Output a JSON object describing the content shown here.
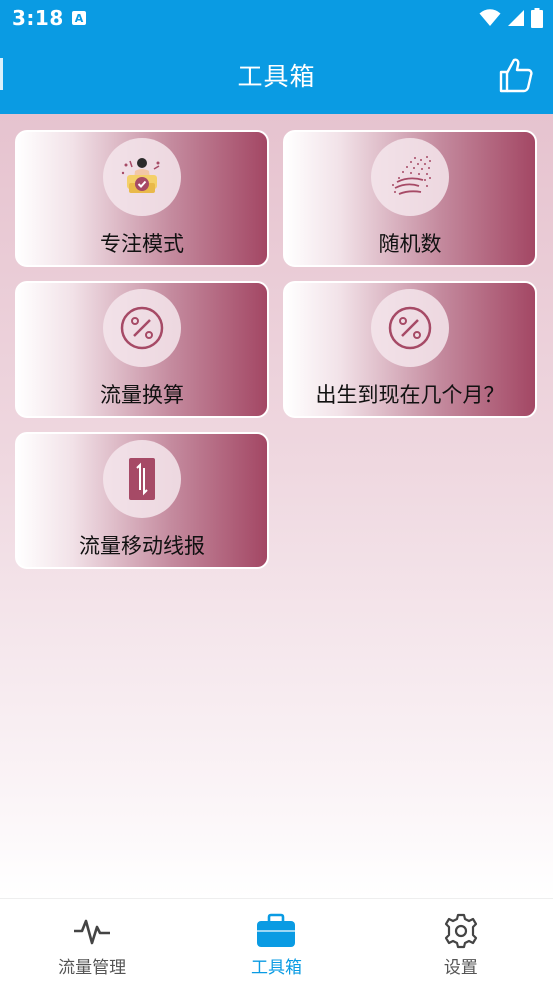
{
  "status_bar": {
    "time": "3:18",
    "notification_letter": "A"
  },
  "app_bar": {
    "title": "工具箱"
  },
  "tools": [
    {
      "label": "专注模式",
      "icon": "focus-person-icon"
    },
    {
      "label": "随机数",
      "icon": "particles-wave-icon"
    },
    {
      "label": "流量换算",
      "icon": "percent-icon"
    },
    {
      "label": "出生到现在几个月？",
      "icon": "percent-icon"
    },
    {
      "label": "流量移动线报",
      "icon": "phone-transfer-icon"
    }
  ],
  "bottom_nav": {
    "items": [
      {
        "label": "流量管理",
        "icon": "pulse-icon",
        "active": false
      },
      {
        "label": "工具箱",
        "icon": "toolbox-icon",
        "active": true
      },
      {
        "label": "设置",
        "icon": "gear-icon",
        "active": false
      }
    ]
  },
  "colors": {
    "primary": "#0a9be3",
    "tile_accent": "#a34764",
    "icon_accent": "#a64a66"
  }
}
